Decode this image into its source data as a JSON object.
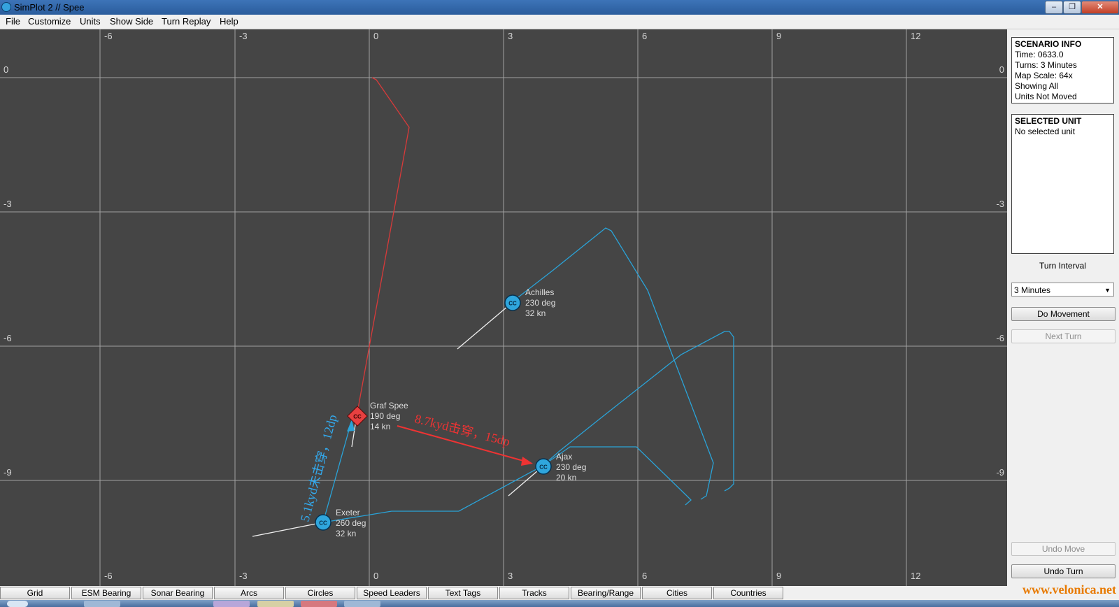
{
  "window": {
    "title": "SimPlot 2 // Spee"
  },
  "menu": [
    "File",
    "Customize",
    "Units",
    "Show Side",
    "Turn Replay",
    "Help"
  ],
  "map": {
    "background": "#454545",
    "x_ticks": [
      "-6",
      "-3",
      "0",
      "3",
      "6",
      "9",
      "12"
    ],
    "y_ticks": [
      "0",
      "-3",
      "-6",
      "-9"
    ],
    "bottom_x_ticks": [
      "-6",
      "-3",
      "0",
      "3",
      "6",
      "9",
      "12"
    ],
    "annotation_red": "8.7kyd击穿，15dp",
    "annotation_blue": "5.1kyd未击穿，12dp"
  },
  "units": [
    {
      "id": "graf-spee",
      "name": "Graf Spee",
      "course": "190 deg",
      "speed": "14 kn",
      "side": "enemy",
      "color": "#e84040",
      "icon": "CC"
    },
    {
      "id": "achilles",
      "name": "Achilles",
      "course": "230 deg",
      "speed": "32 kn",
      "side": "friendly",
      "color": "#2fa6dd",
      "icon": "CC"
    },
    {
      "id": "ajax",
      "name": "Ajax",
      "course": "230 deg",
      "speed": "20 kn",
      "side": "friendly",
      "color": "#2fa6dd",
      "icon": "CC"
    },
    {
      "id": "exeter",
      "name": "Exeter",
      "course": "260 deg",
      "speed": "32 kn",
      "side": "friendly",
      "color": "#2fa6dd",
      "icon": "CC"
    }
  ],
  "scenario_info": {
    "header": "SCENARIO INFO",
    "time": "Time: 0633.0",
    "turns": "Turns: 3 Minutes",
    "scale": "Map Scale: 64x",
    "showing": "Showing All",
    "moved": "Units Not Moved"
  },
  "selected_unit": {
    "header": "SELECTED UNIT",
    "value": "No selected unit"
  },
  "turn_interval": {
    "label": "Turn Interval",
    "selected": "3 Minutes"
  },
  "buttons": {
    "do_movement": "Do Movement",
    "next_turn": "Next Turn",
    "undo_move": "Undo Move",
    "undo_turn": "Undo Turn"
  },
  "bottom_tabs": [
    "Grid",
    "ESM Bearing",
    "Sonar Bearing",
    "Arcs",
    "Circles",
    "Speed Leaders",
    "Text Tags",
    "Tracks",
    "Bearing/Range",
    "Cities",
    "Countries"
  ],
  "watermark": "www.velonica.net",
  "colors": {
    "enemy_track": "#d83a3a",
    "friendly_track": "#2aa3d8",
    "grid": "#b8b8b8",
    "annotation_red": "#ee3333",
    "annotation_blue": "#33aaee"
  }
}
